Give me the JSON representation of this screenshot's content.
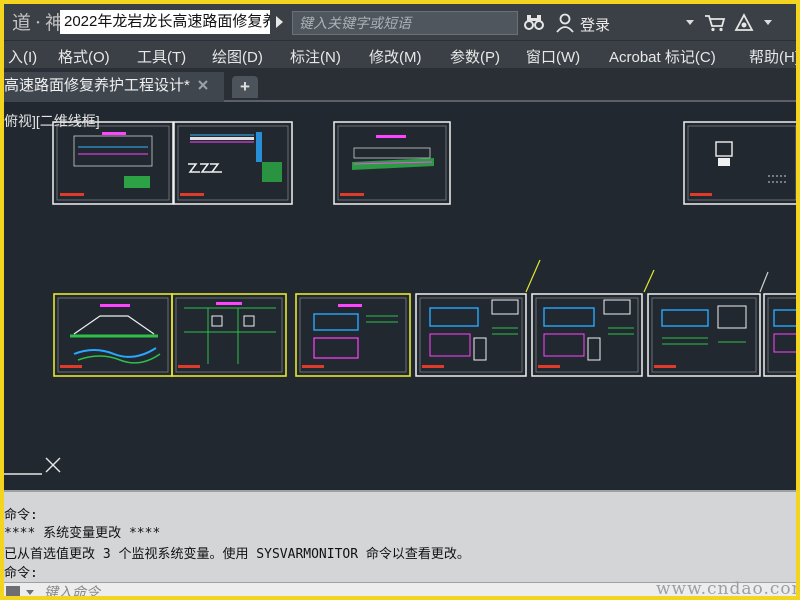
{
  "titlebar": {
    "watermark": "道·神",
    "doc_title": "2022年龙岩龙长高速路面修复养...",
    "search_placeholder": "键入关键字或短语",
    "login_label": "登录"
  },
  "menubar": {
    "items": [
      {
        "label": "入(I)"
      },
      {
        "label": "格式(O)"
      },
      {
        "label": "工具(T)"
      },
      {
        "label": "绘图(D)"
      },
      {
        "label": "标注(N)"
      },
      {
        "label": "修改(M)"
      },
      {
        "label": "参数(P)"
      },
      {
        "label": "窗口(W)"
      },
      {
        "label": "Acrobat 标记(C)"
      },
      {
        "label": "帮助(H)"
      }
    ]
  },
  "tabs": {
    "active_tab": "高速路面修复养护工程设计*",
    "new_tab_glyph": "+"
  },
  "canvas": {
    "viewport_label": "俯视][二维线框]",
    "background_color": "#212830",
    "sheet_border_color": "#ffffff",
    "selected_border_color": "#e6e62e",
    "sheets_row1_count": 4,
    "sheets_row2_count": 7
  },
  "command": {
    "lines": [
      "命令:",
      "**** 系统变量更改 ****",
      "已从首选值更改 3 个监视系统变量。使用 SYSVARMONITOR 命令以查看更改。",
      "命令:"
    ],
    "input_placeholder": "键入命令"
  },
  "site_watermark": "www.cndao.com",
  "colors": {
    "frame_border": "#f3d51f",
    "chrome": "#3b4046"
  }
}
